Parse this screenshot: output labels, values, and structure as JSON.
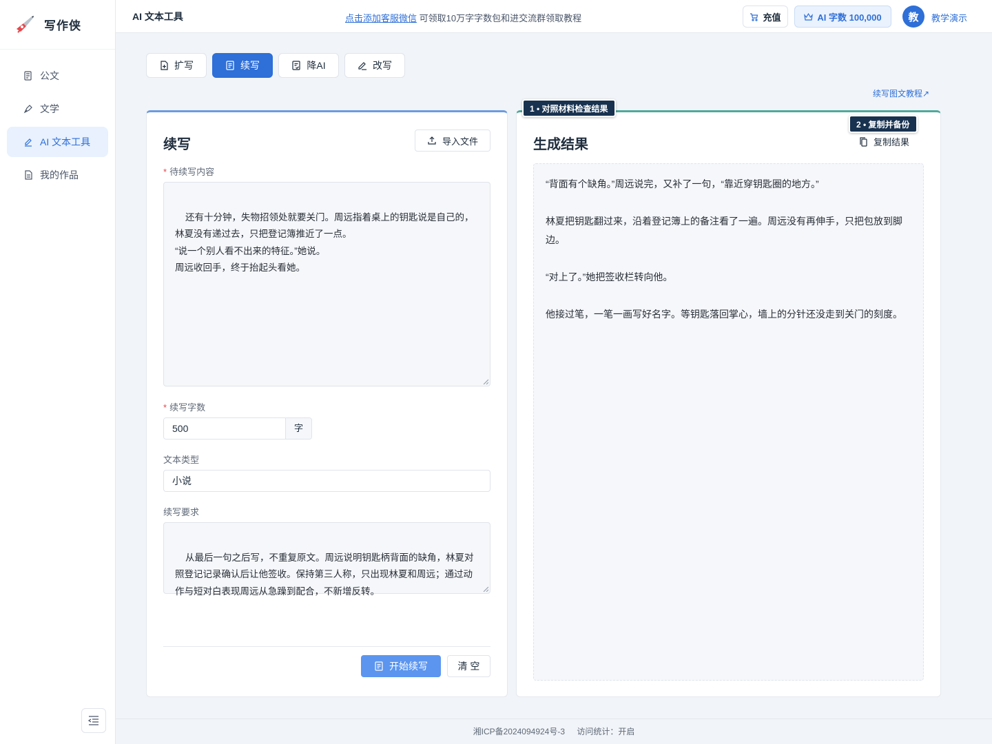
{
  "brand": {
    "name": "写作侠",
    "logo_icon": "pen-rocket-logo"
  },
  "sidebar": {
    "items": [
      {
        "label": "公文",
        "icon": "document-icon"
      },
      {
        "label": "文学",
        "icon": "pen-nib-icon"
      },
      {
        "label": "AI 文本工具",
        "icon": "edit-icon",
        "active": true
      },
      {
        "label": "我的作品",
        "icon": "file-icon"
      }
    ]
  },
  "header": {
    "title": "AI 文本工具",
    "notice_link": "点击添加客服微信",
    "notice_text": "可领取10万字字数包和进交流群领取教程",
    "recharge_label": "充值",
    "quota_label": "AI 字数 100,000",
    "avatar_text": "教",
    "user_name": "教学演示"
  },
  "tabs": [
    {
      "label": "扩写",
      "icon": "file-plus-icon"
    },
    {
      "label": "续写",
      "icon": "file-text-icon",
      "active": true
    },
    {
      "label": "降AI",
      "icon": "file-check-icon"
    },
    {
      "label": "改写",
      "icon": "pencil-icon"
    }
  ],
  "tutorial_link": "续写图文教程↗",
  "left_panel": {
    "title": "续写",
    "import_label": "导入文件",
    "content_label": "待续写内容",
    "content_value": "还有十分钟，失物招领处就要关门。周远指着桌上的钥匙说是自己的，林夏没有递过去，只把登记簿推近了一点。\n“说一个别人看不出来的特征。”她说。\n周远收回手，终于抬起头看她。",
    "word_count_label": "续写字数",
    "word_count_value": "500",
    "word_count_unit": "字",
    "text_type_label": "文本类型",
    "text_type_value": "小说",
    "requirement_label": "续写要求",
    "requirement_value": "从最后一句之后写，不重复原文。周远说明钥匙柄背面的缺角，林夏对照登记记录确认后让他签收。保持第三人称，只出现林夏和周远；通过动作与短对白表现周远从急躁到配合，不新增反转。",
    "start_label": "开始续写",
    "clear_label": "清 空"
  },
  "right_panel": {
    "title": "生成结果",
    "copy_label": "复制结果",
    "paragraphs": [
      "“背面有个缺角。”周远说完，又补了一句，“靠近穿钥匙圈的地方。”",
      "林夏把钥匙翻过来，沿着登记簿上的备注看了一遍。周远没有再伸手，只把包放到脚边。",
      "“对上了。”她把签收栏转向他。",
      "他接过笔，一笔一画写好名字。等钥匙落回掌心，墙上的分针还没走到关门的刻度。"
    ]
  },
  "badges": {
    "step1": "1 • 对照材料检查结果",
    "step2": "2 • 复制并备份"
  },
  "footer": {
    "icp": "湘ICP备2024094924号-3",
    "stats": "访问统计：开启"
  }
}
